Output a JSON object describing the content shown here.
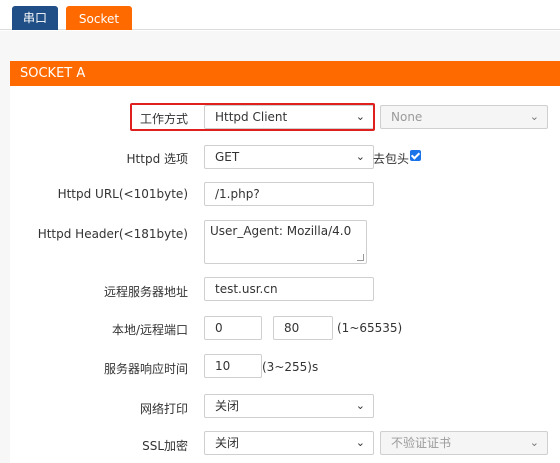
{
  "tabs": [
    {
      "label": "串口"
    },
    {
      "label": "Socket"
    }
  ],
  "section": {
    "title": "SOCKET A"
  },
  "form": {
    "work_mode": {
      "label": "工作方式",
      "value": "Httpd Client",
      "secondary_value": "None"
    },
    "httpd_option": {
      "label": "Httpd 选项",
      "value": "GET",
      "strip_header_label": "去包头",
      "strip_header_checked": true
    },
    "httpd_url": {
      "label": "Httpd URL(<101byte)",
      "value": "/1.php?"
    },
    "httpd_header": {
      "label": "Httpd Header(<181byte)",
      "value": "User_Agent: Mozilla/4.0"
    },
    "remote_server": {
      "label": "远程服务器地址",
      "value": "test.usr.cn"
    },
    "ports": {
      "label": "本地/远程端口",
      "local": "0",
      "remote": "80",
      "range_hint": "(1~65535)"
    },
    "response_time": {
      "label": "服务器响应时间",
      "value": "10",
      "hint": "(3~255)s"
    },
    "net_print": {
      "label": "网络打印",
      "value": "关闭"
    },
    "ssl": {
      "label": "SSL加密",
      "value": "关闭",
      "secondary_value": "不验证证书"
    }
  },
  "colors": {
    "accent": "#ff6a00",
    "tab_inactive": "#1f4f86",
    "highlight": "#e0201f",
    "checkbox": "#1a73e8"
  }
}
